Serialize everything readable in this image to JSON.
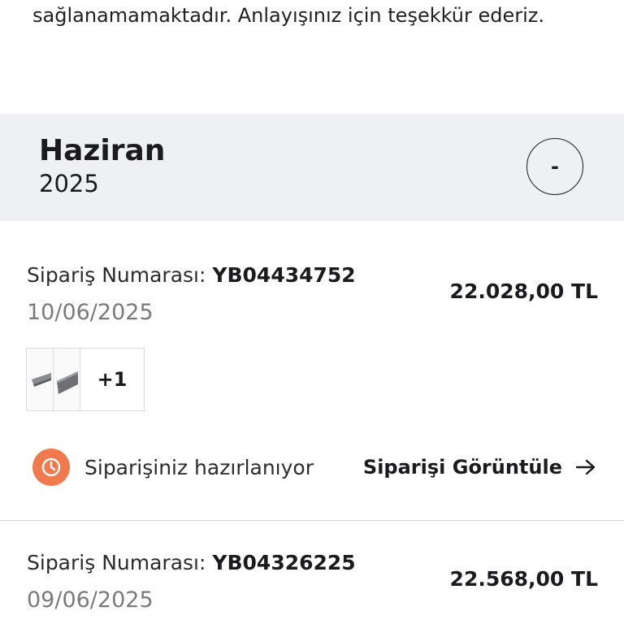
{
  "notice": {
    "text": "sağlanamamaktadır. Anlayışınız için teşekkür ederiz."
  },
  "month_group": {
    "month": "Haziran",
    "year": "2025",
    "toggle_label": "-"
  },
  "orders": [
    {
      "number_label": "Sipariş Numarası:",
      "number": "YB04434752",
      "date": "10/06/2025",
      "total": "22.028,00 TL",
      "extra_items": "+1",
      "status": "Siparişiniz hazırlanıyor",
      "status_color": "#f07a4e",
      "status_icon": "clock-icon",
      "view_label": "Siparişi Görüntüle",
      "view_icon": "arrow-right-icon"
    },
    {
      "number_label": "Sipariş Numarası:",
      "number": "YB04326225",
      "date": "09/06/2025",
      "total": "22.568,00 TL"
    }
  ]
}
